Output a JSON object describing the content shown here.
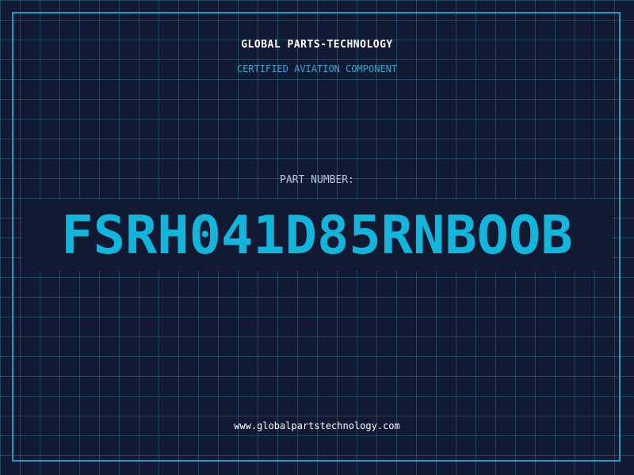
{
  "header": {
    "company": "GLOBAL PARTS-TECHNOLOGY",
    "subtitle": "CERTIFIED AVIATION COMPONENT"
  },
  "main": {
    "label": "PART NUMBER:",
    "part_number": "FSRH041D85RNBOOB"
  },
  "footer": {
    "url": "www.globalpartstechnology.com"
  },
  "colors": {
    "background": "#121a33",
    "grid": "#286e8c",
    "accent": "#12b6dd",
    "frame": "#1c9cc2"
  }
}
